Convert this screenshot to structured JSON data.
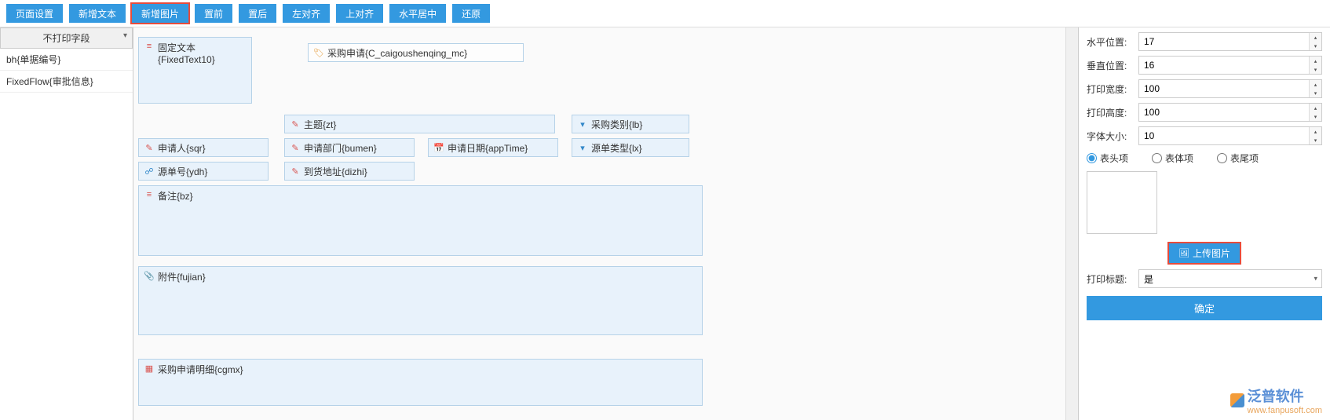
{
  "toolbar": {
    "page_settings": "页面设置",
    "add_text": "新增文本",
    "add_image": "新增图片",
    "bring_front": "置前",
    "send_back": "置后",
    "align_left": "左对齐",
    "align_top": "上对齐",
    "center_h": "水平居中",
    "restore": "还原"
  },
  "left_panel": {
    "header": "不打印字段",
    "items": [
      "bh{单据编号}",
      "FixedFlow{审批信息}"
    ]
  },
  "canvas": {
    "fixed_text": "固定文本\n{FixedText10}",
    "tag_caigou": "采购申请{C_caigoushenqing_mc}",
    "f_zhuti": "主题{zt}",
    "f_caigouleibie": "采购类别{lb}",
    "f_shenqingren": "申请人{sqr}",
    "f_shenqingbumen": "申请部门{bumen}",
    "f_shenqingriji": "申请日期{appTime}",
    "f_yuandanleixing": "源单类型{lx}",
    "f_yuandanhao": "源单号{ydh}",
    "f_daohuodizhi": "到货地址{dizhi}",
    "f_beizhu": "备注{bz}",
    "f_fujian": "附件{fujian}",
    "f_mingxi": "采购申请明细{cgmx}"
  },
  "props": {
    "h_pos_label": "水平位置:",
    "h_pos": "17",
    "v_pos_label": "垂直位置:",
    "v_pos": "16",
    "width_label": "打印宽度:",
    "width": "100",
    "height_label": "打印高度:",
    "height": "100",
    "font_label": "字体大小:",
    "font": "10",
    "radio_header": "表头项",
    "radio_body": "表体项",
    "radio_footer": "表尾项",
    "upload": "上传图片",
    "print_title_label": "打印标题:",
    "print_title_value": "是",
    "confirm": "确定"
  },
  "watermark": {
    "brand": "泛普软件",
    "url": "www.fanpusoft.com"
  }
}
